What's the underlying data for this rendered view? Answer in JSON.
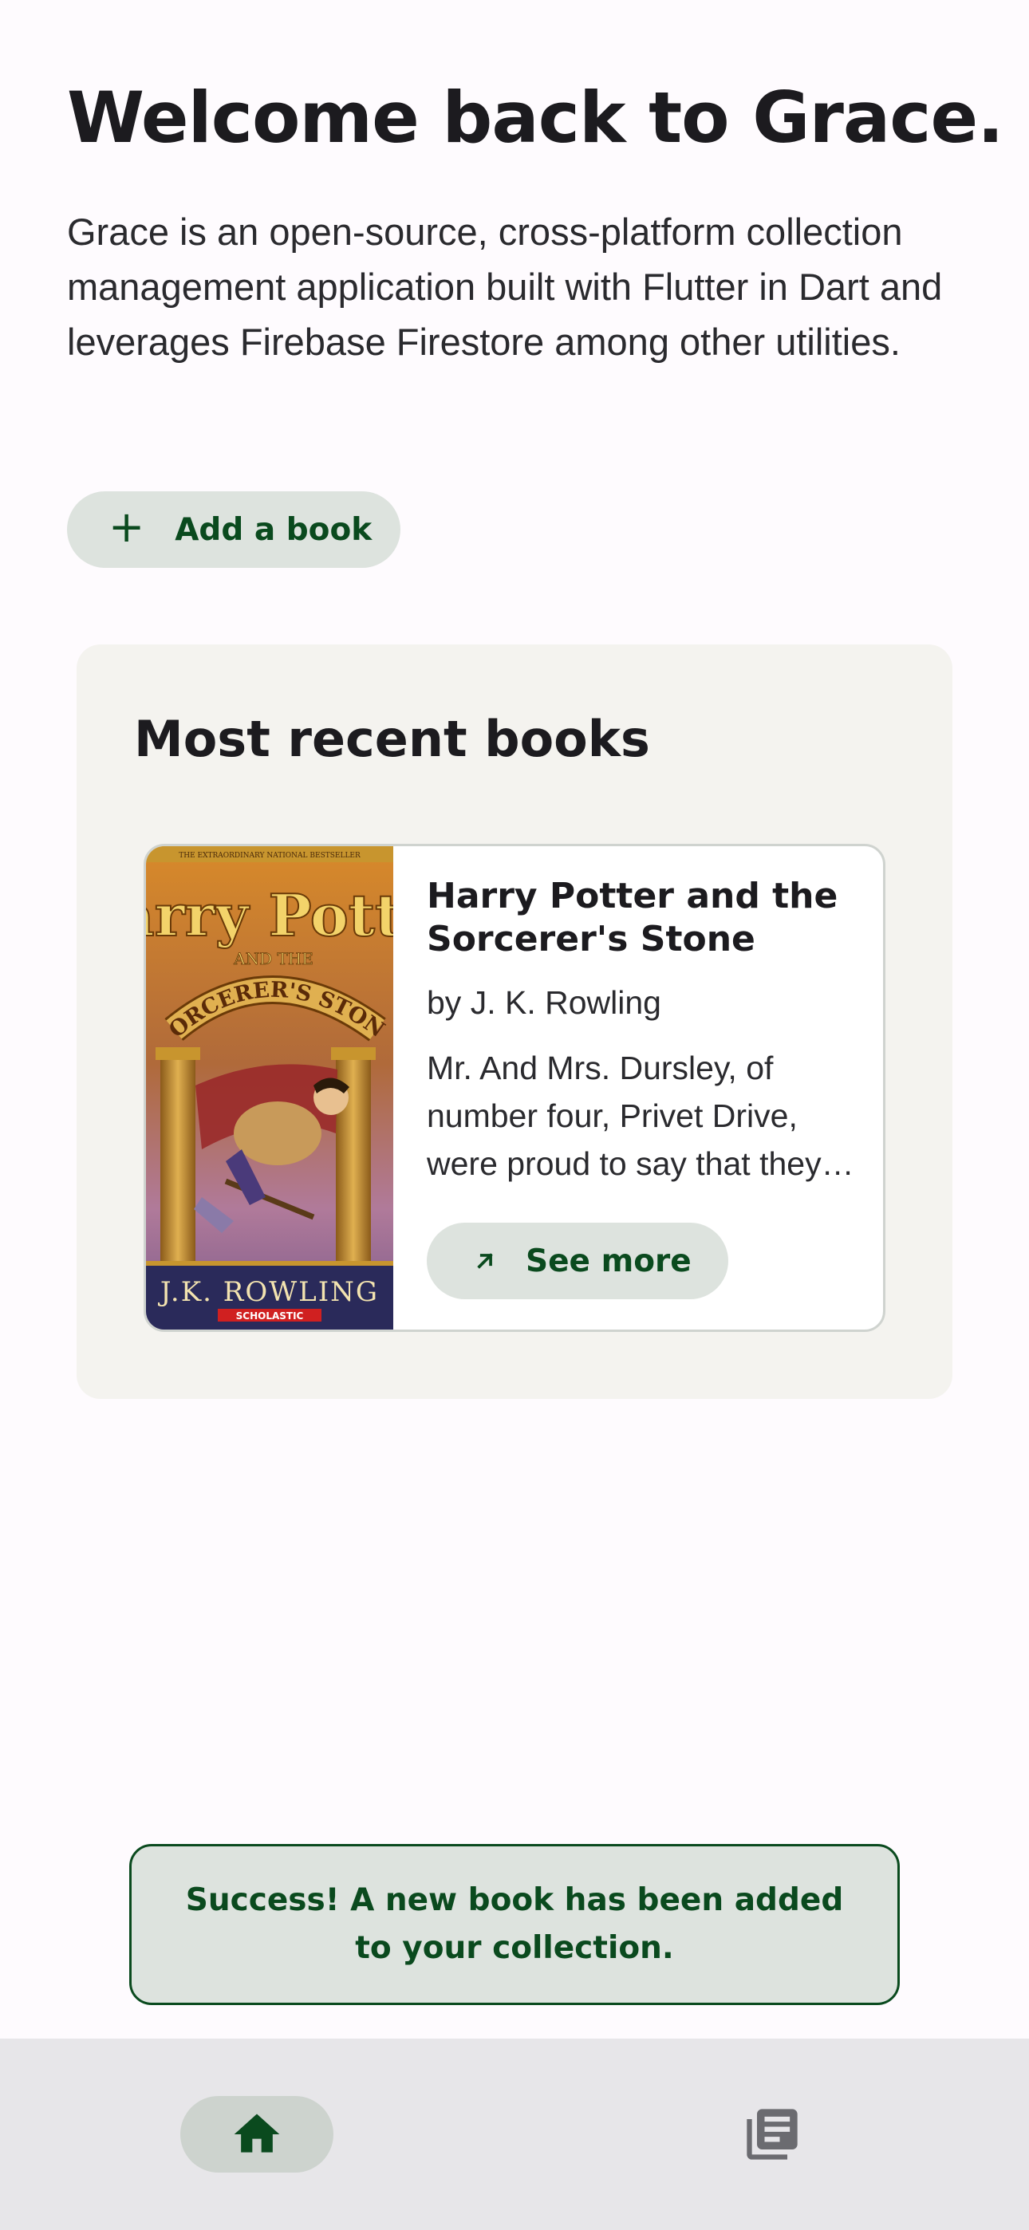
{
  "header": {
    "title": "Welcome back to Grace.",
    "description": "Grace is an open-source, cross-platform collection management application built with Flutter in Dart and leverages Firebase Firestore among other utilities."
  },
  "actions": {
    "add_book_label": "Add a book",
    "add_book_icon": "plus-icon"
  },
  "recent": {
    "title": "Most recent books",
    "books": [
      {
        "title": "Harry Potter and the Sorcerer's Stone",
        "author": "by J. K. Rowling",
        "description": "Mr. And Mrs. Dursley, of number four, Privet Drive, were proud to say that they were perfectly normal, thank you very much.",
        "see_more_label": "See more",
        "see_more_icon": "arrow-up-right-icon",
        "cover": {
          "top_text": "THE EXTRAORDINARY NATIONAL BESTSELLER",
          "title_line1": "Harry Potter",
          "title_line2": "AND THE",
          "title_line3": "SORCERER'S STONE",
          "author_text": "J.K. ROWLING",
          "publisher_text": "SCHOLASTIC"
        }
      }
    ]
  },
  "snackbar": {
    "message": "Success! A new book has been added to your collection."
  },
  "nav": {
    "items": [
      {
        "icon": "home-icon",
        "selected": true
      },
      {
        "icon": "library-books-icon",
        "selected": false
      }
    ]
  },
  "colors": {
    "background": "#fefbfe",
    "accent": "#0a4a1e",
    "tonal_button": "#dde3de",
    "panel": "#f4f3ef",
    "nav_bar": "#e7e6e9"
  }
}
